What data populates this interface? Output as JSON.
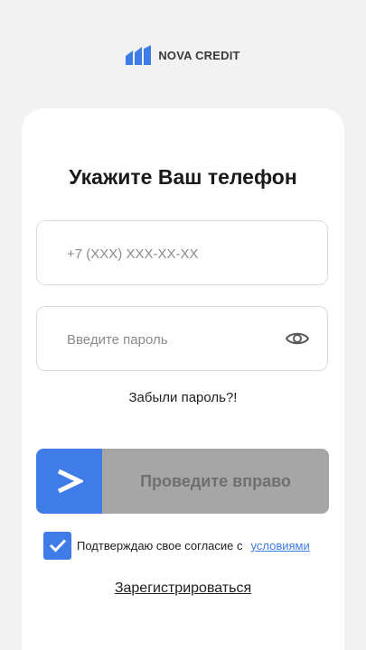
{
  "brand": {
    "name": "NOVA CREDIT",
    "accent_color": "#3f7ce8"
  },
  "login": {
    "title": "Укажите Ваш телефон",
    "phone_placeholder": "+7 (XXX) XXX-XX-XX",
    "phone_value": "",
    "password_placeholder": "Введите пароль",
    "password_value": "",
    "password_toggle_icon": "eye-icon",
    "forgot_password": "Забыли пароль?!",
    "slider_label": "Проведите вправо",
    "slider_icon": "chevron-right-icon",
    "consent_checked": true,
    "consent_text": "Подтверждаю свое согласие с",
    "consent_link": "условиями",
    "register": "Зарегистрироваться"
  }
}
